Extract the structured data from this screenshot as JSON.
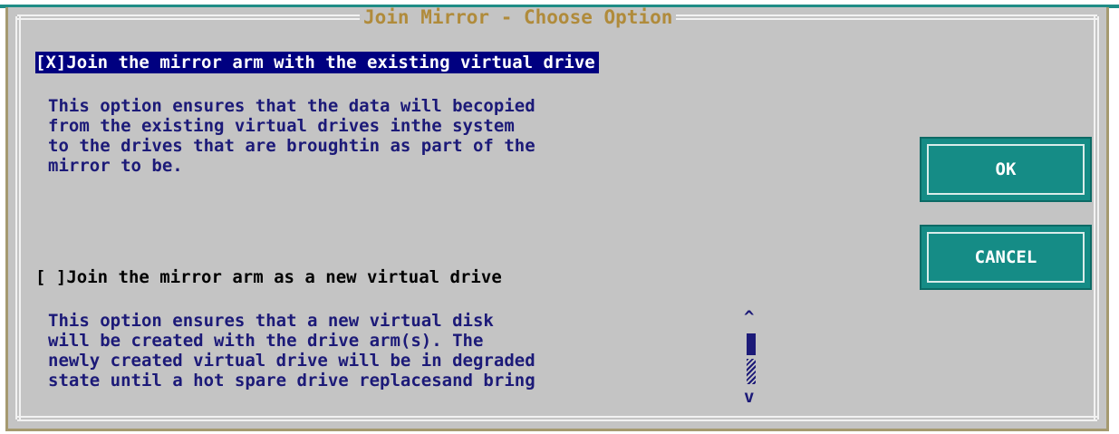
{
  "dialog": {
    "title": "Join Mirror - Choose Option"
  },
  "options": [
    {
      "label": "[X]Join the mirror arm with the existing virtual drive",
      "checked": true,
      "description": "This option ensures that the data will becopied\nfrom the existing virtual drives inthe system\nto the drives that are broughtin as part of the\nmirror to be."
    },
    {
      "label": "[ ]Join the mirror arm as a new virtual drive",
      "checked": false,
      "description": "This option ensures that a new virtual disk\nwill be created with the drive arm(s). The\nnewly created virtual drive will be in degraded\nstate until a hot spare drive replacesand bring"
    }
  ],
  "buttons": {
    "ok": "OK",
    "cancel": "CANCEL"
  },
  "scrollbar": {
    "up_glyph": "^",
    "down_glyph": "v"
  },
  "colors": {
    "dialog_bg": "#c4c4c4",
    "title": "#b08b3b",
    "selection": "#000080",
    "text": "#1c1a78",
    "button": "#158c86"
  }
}
